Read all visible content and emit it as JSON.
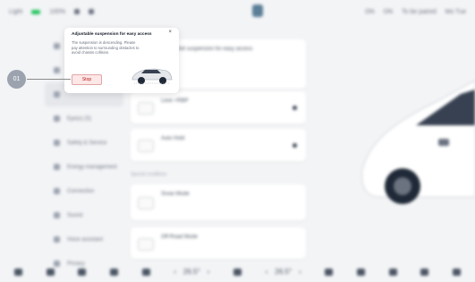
{
  "status": {
    "left_items": [
      "Light",
      "100%"
    ],
    "right_items": [
      "ON",
      "ON",
      "To be paired",
      "Mo Tue"
    ]
  },
  "sidebar": {
    "items": [
      {
        "label": "",
        "active": false
      },
      {
        "label": "",
        "active": false
      },
      {
        "label": "",
        "active": true
      },
      {
        "label": "Eye(s) (S)",
        "active": false
      },
      {
        "label": "Safety & Service",
        "active": false
      },
      {
        "label": "Energy management",
        "active": false
      },
      {
        "label": "Connection",
        "active": false
      },
      {
        "label": "Sound",
        "active": false
      },
      {
        "label": "Voice assistant",
        "active": false
      },
      {
        "label": "Privacy",
        "active": false
      }
    ]
  },
  "content": {
    "card1": {
      "title": "Set suspension for easy access",
      "desc": ""
    },
    "card2": {
      "title": "Leve +RBP",
      "desc": ""
    },
    "card3": {
      "title": "Auto Hold",
      "desc": ""
    },
    "section_label": "Special conditions",
    "card4": {
      "title": "Snow Mode",
      "desc": ""
    },
    "card5": {
      "title": "Off-Road Mode",
      "desc": ""
    }
  },
  "bottombar": {
    "temp_left": "26.5°",
    "temp_right": "26.5°",
    "left_arrow": "‹",
    "right_arrow": "›"
  },
  "popup": {
    "title": "Adjustable suspension for easy access",
    "body": "The suspension is descending. Please pay attention to surrounding obstacles to avoid chassis collision.",
    "button_label": "Stop",
    "close_label": "×"
  },
  "callout": {
    "label": "01"
  },
  "colors": {
    "accent_red": "#b91c1c",
    "button_bg": "#fde7e7",
    "background": "#f3f4f6"
  }
}
